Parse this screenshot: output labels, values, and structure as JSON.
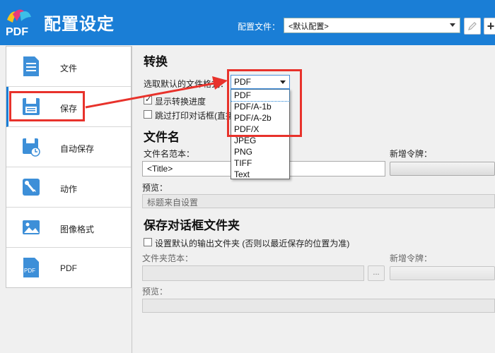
{
  "header": {
    "logo_text": "PDF",
    "title": "配置设定",
    "profile_label": "配置文件：",
    "profile_value": "<默认配置>",
    "edit_icon": "pencil-icon",
    "add_label": "+"
  },
  "sidebar": {
    "items": [
      {
        "label": "文件",
        "icon": "document-icon"
      },
      {
        "label": "保存",
        "icon": "save-icon"
      },
      {
        "label": "自动保存",
        "icon": "autosave-icon"
      },
      {
        "label": "动作",
        "icon": "wrench-icon"
      },
      {
        "label": "图像格式",
        "icon": "image-icon"
      },
      {
        "label": "PDF",
        "icon": "pdf-icon"
      }
    ],
    "pdf_icon_text": "PDF"
  },
  "convert": {
    "title": "转换",
    "format_label": "选取默认的文件格式：",
    "format_value": "PDF",
    "show_progress_label": "显示转换进度",
    "show_progress_checked": true,
    "skip_print_label": "跳过打印对话框(直接",
    "skip_print_checked": false,
    "options": [
      "PDF",
      "PDF/A-1b",
      "PDF/A-2b",
      "PDF/X",
      "JPEG",
      "PNG",
      "TIFF",
      "Text"
    ]
  },
  "filename": {
    "title": "文件名",
    "template_label": "文件名范本：",
    "template_value": "<Title>",
    "token_label": "新增令牌：",
    "preview_label": "预览：",
    "preview_value": "标题来自设置"
  },
  "save_dialog": {
    "title": "保存对话框文件夹",
    "default_folder_label": "设置默认的输出文件夹 (否则以最近保存的位置为准)",
    "default_folder_checked": false,
    "folder_template_label": "文件夹范本：",
    "browse_label": "...",
    "token_label": "新增令牌：",
    "preview_label": "预览："
  },
  "colors": {
    "accent": "#1a7ed6",
    "annotation": "#e8322b"
  }
}
